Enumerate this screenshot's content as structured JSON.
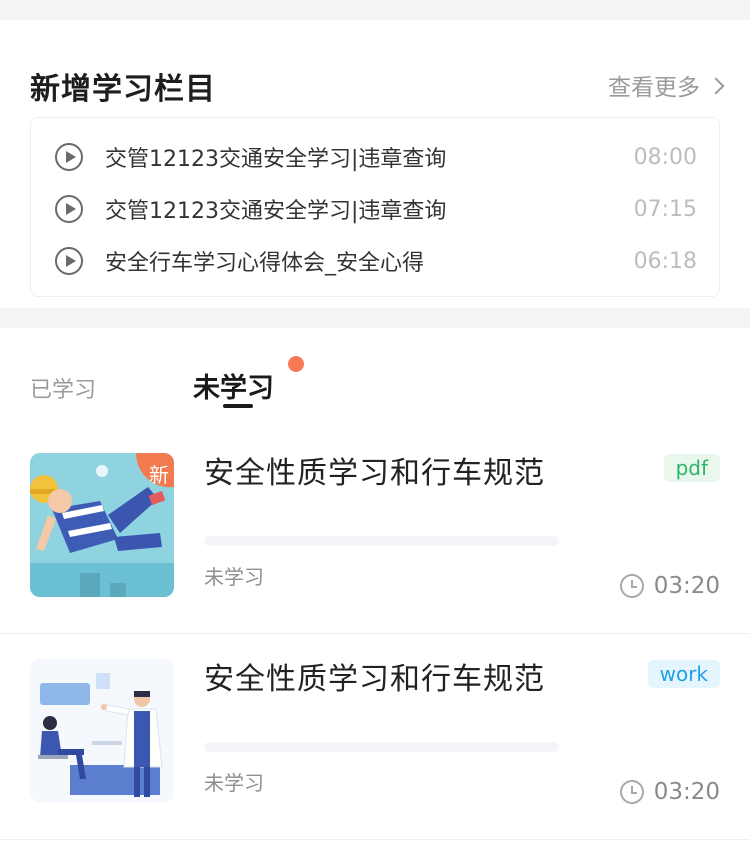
{
  "recent": {
    "title": "新增学习栏目",
    "more_label": "查看更多",
    "items": [
      {
        "title": "交管12123交通安全学习|违章查询",
        "duration": "08:00"
      },
      {
        "title": "交管12123交通安全学习|违章查询",
        "duration": "07:15"
      },
      {
        "title": "安全行车学习心得体会_安全心得",
        "duration": "06:18"
      }
    ]
  },
  "tabs": {
    "learned": "已学习",
    "unlearned": "未学习"
  },
  "courses": [
    {
      "title": "安全性质学习和行车规范",
      "tag": "pdf",
      "tag_bg": "#eaf7ed",
      "tag_color": "#2fb56a",
      "badge": "新",
      "progress": 0,
      "status": "未学习",
      "duration": "03:20"
    },
    {
      "title": "安全性质学习和行车规范",
      "tag": "work",
      "tag_bg": "#e5f5fd",
      "tag_color": "#1fa1e3",
      "progress": 0,
      "status": "未学习",
      "duration": "03:20"
    }
  ]
}
